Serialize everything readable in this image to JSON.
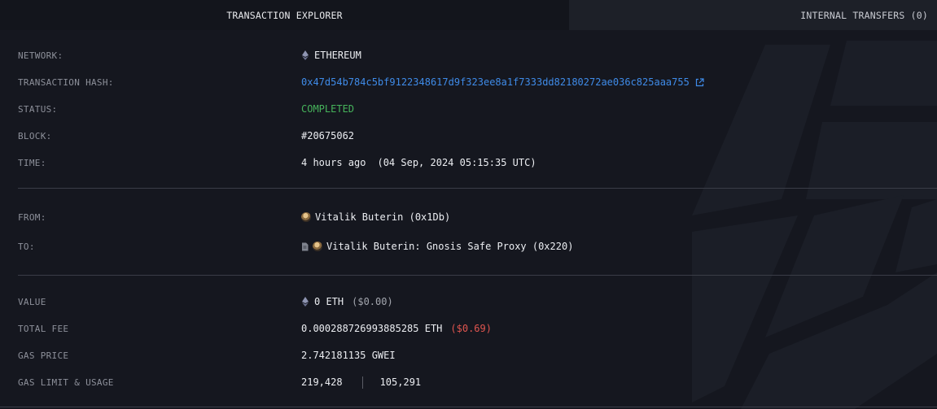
{
  "tabs": {
    "active": "TRANSACTION EXPLORER",
    "inactive": "INTERNAL TRANSFERS (0)"
  },
  "details": {
    "network": {
      "label": "NETWORK:",
      "value": "ETHEREUM",
      "icon": "ethereum-icon"
    },
    "hash": {
      "label": "TRANSACTION HASH:",
      "value": "0x47d54b784c5bf9122348617d9f323ee8a1f7333dd82180272ae036c825aaa755",
      "icon": "external-link-icon"
    },
    "status": {
      "label": "STATUS:",
      "value": "COMPLETED",
      "color": "#46b35b"
    },
    "block": {
      "label": "BLOCK:",
      "value": "#20675062"
    },
    "time": {
      "label": "TIME:",
      "relative": "4 hours ago",
      "absolute": "(04 Sep, 2024 05:15:35 UTC)"
    }
  },
  "parties": {
    "from": {
      "label": "FROM:",
      "value": "Vitalik Buterin (0x1Db)"
    },
    "to": {
      "label": "TO:",
      "value": "Vitalik Buterin: Gnosis Safe Proxy (0x220)",
      "icon": "contract-icon"
    }
  },
  "fees": {
    "value": {
      "label": "VALUE",
      "amount": "0 ETH",
      "usd": "($0.00)"
    },
    "total_fee": {
      "label": "TOTAL FEE",
      "amount": "0.000288726993885285 ETH",
      "usd": "($0.69)",
      "usd_color": "#e0554f"
    },
    "gas_price": {
      "label": "GAS PRICE",
      "value": "2.742181135 GWEI"
    },
    "gas_limit": {
      "label": "GAS LIMIT & USAGE",
      "limit": "219,428",
      "usage": "105,291"
    }
  },
  "colors": {
    "background": "#15171f",
    "link": "#3f8be8",
    "success": "#46b35b",
    "negative": "#e0554f"
  }
}
